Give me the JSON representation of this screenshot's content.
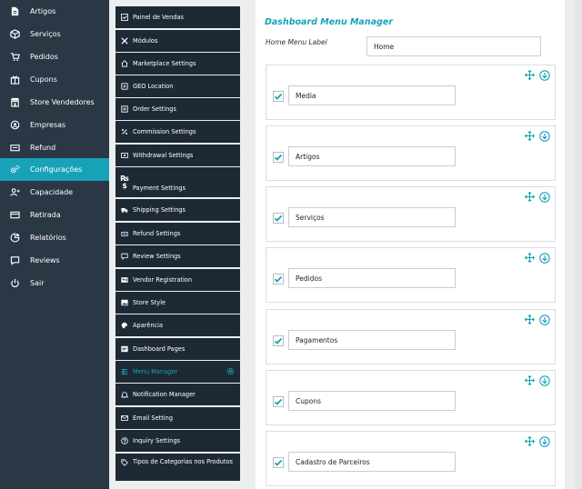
{
  "sidebar": {
    "items": [
      {
        "label": "Artigos",
        "icon": "file-icon"
      },
      {
        "label": "Serviços",
        "icon": "box-icon"
      },
      {
        "label": "Pedidos",
        "icon": "cart-icon"
      },
      {
        "label": "Cupons",
        "icon": "gift-icon"
      },
      {
        "label": "Store Vendedores",
        "icon": "store-icon"
      },
      {
        "label": "Empresas",
        "icon": "badge-icon"
      },
      {
        "label": "Refund",
        "icon": "refund-icon"
      },
      {
        "label": "Configurações",
        "icon": "gears-icon",
        "active": true
      },
      {
        "label": "Capacidade",
        "icon": "user-plus-icon"
      },
      {
        "label": "Retirada",
        "icon": "money-icon"
      },
      {
        "label": "Relatórios",
        "icon": "chart-icon"
      },
      {
        "label": "Reviews",
        "icon": "comment-icon"
      },
      {
        "label": "Sair",
        "icon": "power-icon"
      }
    ],
    "active_color": "#17a2b8"
  },
  "submenu": {
    "items": [
      {
        "label": "Painel de Vendas",
        "icon": "dashboard-icon"
      },
      {
        "label": "Módulos",
        "icon": "modules-icon"
      },
      {
        "label": "Marketplace Settings",
        "icon": "home-icon"
      },
      {
        "label": "GEO Location",
        "icon": "globe-icon"
      },
      {
        "label": "Order Settings",
        "icon": "cart-icon"
      },
      {
        "label": "Commission Settings",
        "icon": "percent-icon"
      },
      {
        "label": "Withdrawal Settings",
        "icon": "money-icon"
      },
      {
        "label": "Payment Settings",
        "icon": "rupee-dollar-icon"
      },
      {
        "label": "Shipping Settings",
        "icon": "truck-icon"
      },
      {
        "label": "Refund Settings",
        "icon": "refund-icon"
      },
      {
        "label": "Review Settings",
        "icon": "comment-icon"
      },
      {
        "label": "Vendor Registration",
        "icon": "user-card-icon"
      },
      {
        "label": "Store Style",
        "icon": "image-icon"
      },
      {
        "label": "Aparência",
        "icon": "palette-icon"
      },
      {
        "label": "Dashboard Pages",
        "icon": "pages-icon"
      },
      {
        "label": "Menu Manager",
        "icon": "list-icon",
        "active": true
      },
      {
        "label": "Notification Manager",
        "icon": "bell-icon"
      },
      {
        "label": "Email Setting",
        "icon": "envelope-icon"
      },
      {
        "label": "Inquiry Settings",
        "icon": "question-icon"
      },
      {
        "label": "Tipos de Categorias nos Produtos",
        "icon": "tags-icon"
      }
    ]
  },
  "panel": {
    "title": "Dashboard Menu Manager",
    "home_label": "Home Menu Label",
    "home_value": "Home",
    "menu_items": [
      {
        "value": "Media",
        "checked": true
      },
      {
        "value": "Artigos",
        "checked": true
      },
      {
        "value": "Serviços",
        "checked": true
      },
      {
        "value": "Pedidos",
        "checked": true
      },
      {
        "value": "Pagamentos",
        "checked": true
      },
      {
        "value": "Cupons",
        "checked": true
      },
      {
        "value": "Cadastro de Parceiros",
        "checked": true
      }
    ]
  },
  "colors": {
    "sidebar_bg": "#2a3744",
    "submenu_bg": "#1d2a35",
    "accent": "#17a2b8"
  }
}
